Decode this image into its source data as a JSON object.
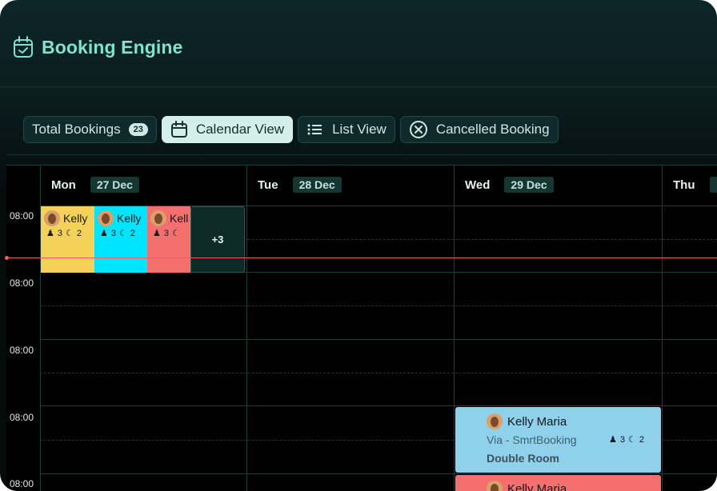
{
  "app": {
    "title": "Booking Engine"
  },
  "tabs": [
    {
      "label": "Total Bookings",
      "badge": "23"
    },
    {
      "label": "Calendar View"
    },
    {
      "label": "List View"
    },
    {
      "label": "Cancelled Booking"
    }
  ],
  "calendar": {
    "days": [
      {
        "name": "Mon",
        "date": "27 Dec"
      },
      {
        "name": "Tue",
        "date": "28 Dec"
      },
      {
        "name": "Wed",
        "date": "29 Dec"
      },
      {
        "name": "Thu",
        "date": ""
      }
    ],
    "times": [
      "08:00",
      "08:00",
      "08:00",
      "08:00",
      "08:00"
    ],
    "mon_events": [
      {
        "name": "Kelly",
        "guests": "3",
        "nights": "2",
        "color": "#f4d25a"
      },
      {
        "name": "Kelly",
        "guests": "3",
        "nights": "2",
        "color": "#00e5ff"
      },
      {
        "name": "Kell",
        "guests": "3",
        "nights": "",
        "color": "#f4706e"
      }
    ],
    "more": "+3",
    "wed_event": {
      "name": "Kelly Maria",
      "via": "Via - SmrtBooking",
      "room": "Double Room",
      "guests": "3",
      "nights": "2",
      "color": "#8fd0ea"
    },
    "wed_event2": {
      "name": "Kelly Maria",
      "color": "#f4706e"
    }
  }
}
